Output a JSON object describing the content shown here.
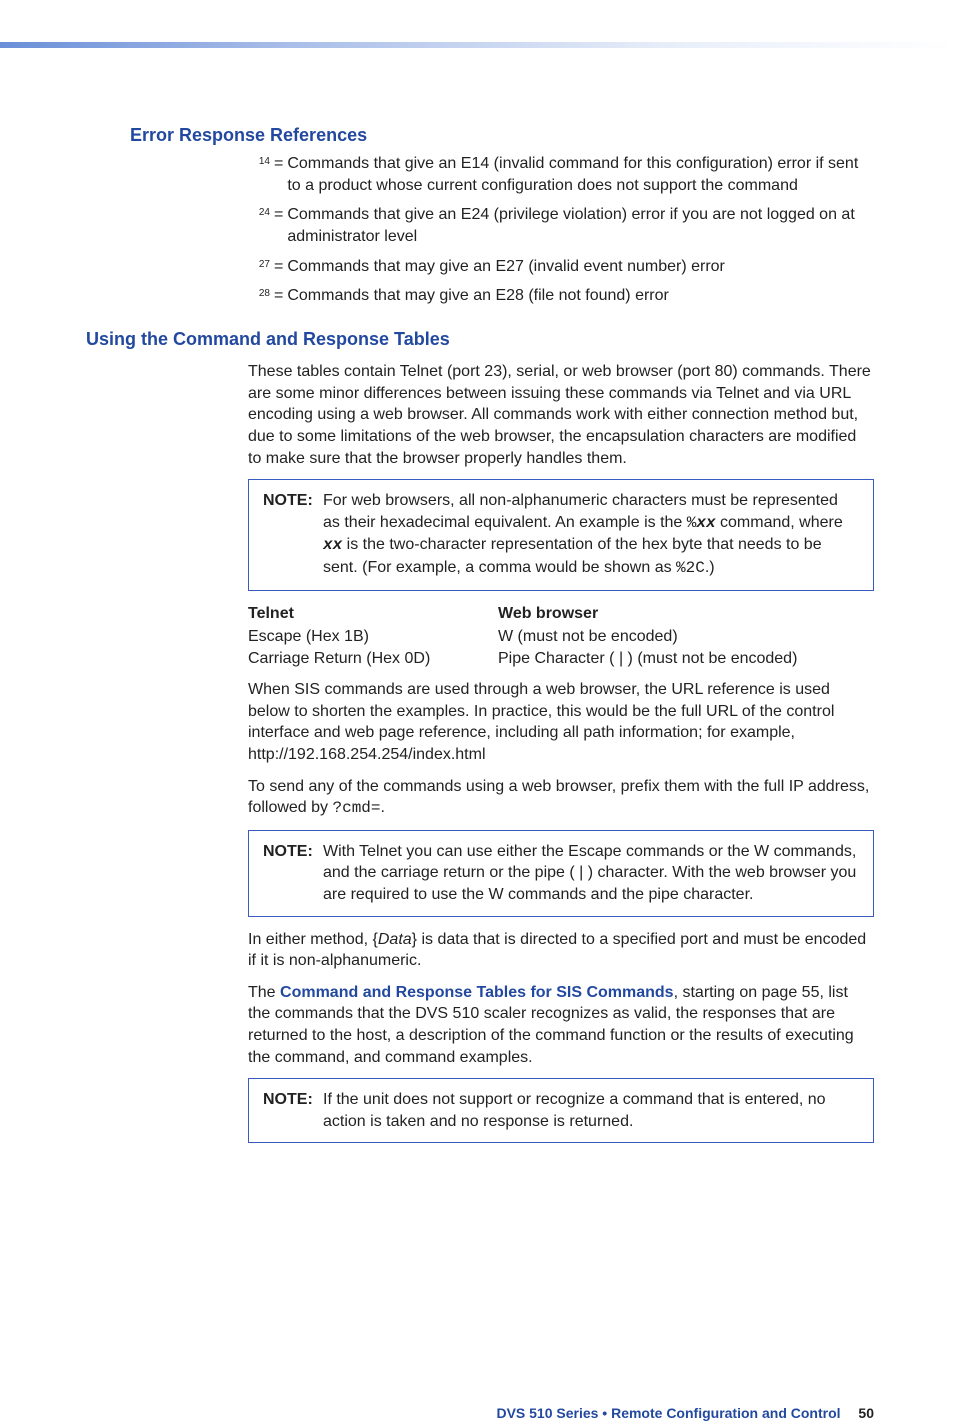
{
  "section1": {
    "title": "Error Response References",
    "refs": [
      {
        "sup": "14",
        "text": "Commands that give an E14 (invalid command for this configuration) error if sent to a product whose current configuration does not support the command"
      },
      {
        "sup": "24",
        "text": "Commands that give an E24 (privilege violation) error if you are not logged on at administrator level"
      },
      {
        "sup": "27",
        "text": "Commands that may give an E27 (invalid event number) error"
      },
      {
        "sup": "28",
        "text": "Commands that may give an E28 (file not found) error"
      }
    ]
  },
  "section2": {
    "title": "Using the Command and Response Tables",
    "intro": "These tables contain Telnet (port 23), serial, or web browser (port 80) commands. There are some minor differences between issuing these commands via Telnet and via URL encoding using a web browser. All commands work with either connection method but, due to some limitations of the web browser, the encapsulation characters are modified to make sure that the browser properly handles them.",
    "note1_label": "NOTE:",
    "note1_a": "For web browsers, all non-alphanumeric characters must be represented as their hexadecimal equivalent. An example is the ",
    "note1_code1": "%xx",
    "note1_b": " command, where ",
    "note1_code2": "xx",
    "note1_c": " is the two-character representation of the hex byte that needs to be sent. (For example, a comma would be shown as ",
    "note1_code3": "%2C",
    "note1_d": ".)",
    "cols": {
      "h1": "Telnet",
      "h2": "Web browser",
      "r1c1": "Escape (Hex 1B)",
      "r1c2": "W (must not be encoded)",
      "r2c1": "Carriage Return (Hex 0D)",
      "r2c2": "Pipe Character ( | ) (must not be encoded)"
    },
    "p2": "When SIS commands are used through a web browser, the URL reference is used below to shorten the examples. In practice, this would be the full URL of the control interface and web page reference, including all path information; for example, http://192.168.254.254/index.html",
    "p3a": "To send any of the commands using a web browser, prefix them with the full IP address, followed by ",
    "p3code": "?cmd=",
    "p3b": ".",
    "note2_label": "NOTE:",
    "note2": "With Telnet you can use either the Escape commands or the W commands, and the carriage return or the pipe ( | ) character. With the web browser you are required to use the W commands and the pipe character.",
    "p4a": "In either method, {",
    "p4i": "Data",
    "p4b": "} is data that is directed to a specified port and must be encoded if it is non-alphanumeric.",
    "p5a": "The ",
    "p5link": "Command and Response Tables for SIS Commands",
    "p5b": ", starting on page 55, list the commands that the DVS 510 scaler recognizes as valid, the responses that are returned to the host, a description of the command function or the results of executing the command, and command examples.",
    "note3_label": "NOTE:",
    "note3": "If the unit does not support or recognize a command that is entered, no action is taken and no response is returned."
  },
  "footer": {
    "series": "DVS 510 Series • Remote Configuration and Control",
    "page": "50"
  }
}
